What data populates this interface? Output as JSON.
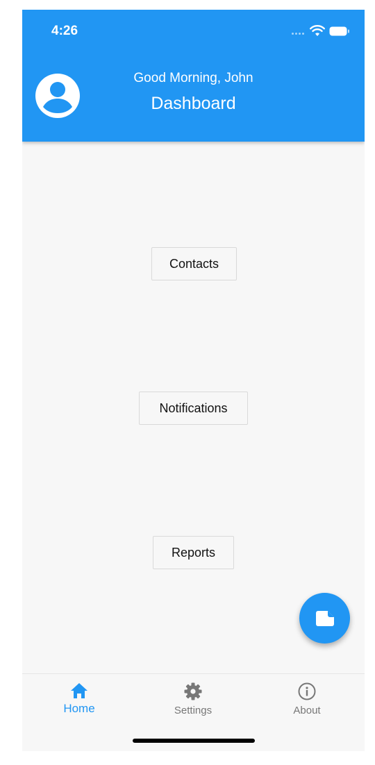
{
  "status_bar": {
    "time": "4:26"
  },
  "header": {
    "greeting": "Good Morning, John",
    "title": "Dashboard",
    "avatar_icon": "account-circle-icon"
  },
  "main": {
    "buttons": [
      {
        "label": "Contacts"
      },
      {
        "label": "Notifications"
      },
      {
        "label": "Reports"
      }
    ]
  },
  "fab": {
    "icon": "note-icon"
  },
  "bottom_nav": {
    "items": [
      {
        "label": "Home",
        "icon": "home-icon",
        "active": true
      },
      {
        "label": "Settings",
        "icon": "gear-icon",
        "active": false
      },
      {
        "label": "About",
        "icon": "info-icon",
        "active": false
      }
    ]
  },
  "colors": {
    "primary": "#2196f3",
    "background": "#f7f7f7",
    "inactive": "#777777"
  }
}
